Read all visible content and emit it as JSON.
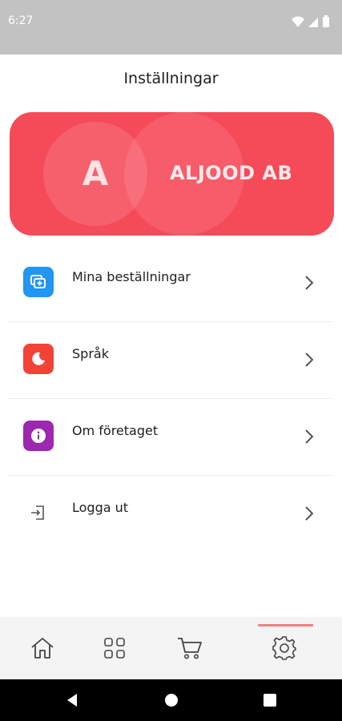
{
  "status_bar": {
    "time": "6:27"
  },
  "header": {
    "title": "Inställningar"
  },
  "profile": {
    "initial": "A",
    "company": "ALJOOD AB",
    "accent": "#f54a58"
  },
  "menu": {
    "items": [
      {
        "label": "Mina beställningar",
        "icon": "orders-icon",
        "color": "#2196f3"
      },
      {
        "label": "Språk",
        "icon": "language-icon",
        "color": "#f44336"
      },
      {
        "label": "Om företaget",
        "icon": "info-icon",
        "color": "#9c27b0"
      },
      {
        "label": "Logga ut",
        "icon": "logout-icon",
        "color": "#555555"
      }
    ]
  },
  "bottom_nav": {
    "tabs": [
      {
        "icon": "home-icon"
      },
      {
        "icon": "grid-icon"
      },
      {
        "icon": "cart-icon"
      },
      {
        "icon": "gear-icon",
        "active": true
      }
    ]
  }
}
